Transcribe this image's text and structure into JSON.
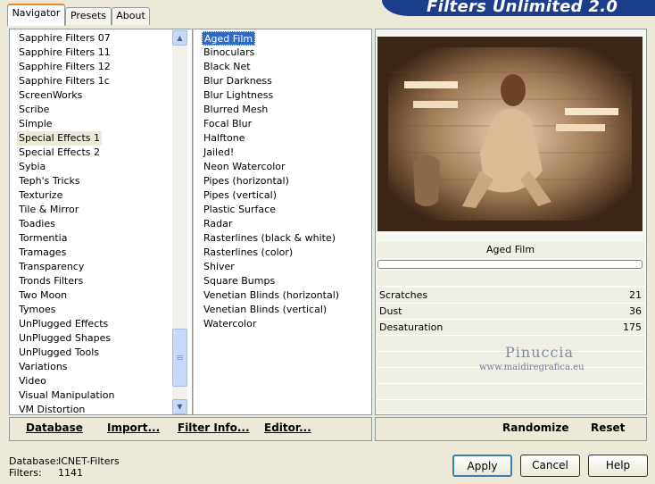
{
  "tabs": [
    "Navigator",
    "Presets",
    "About"
  ],
  "banner_title": "Filters Unlimited 2.0",
  "categories": [
    "Sapphire Filters 07",
    "Sapphire Filters 11",
    "Sapphire Filters 12",
    "Sapphire Filters 1c",
    "ScreenWorks",
    "Scribe",
    "Simple",
    "Special Effects 1",
    "Special Effects 2",
    "Sybia",
    "Teph's Tricks",
    "Texturize",
    "Tile & Mirror",
    "Toadies",
    "Tormentia",
    "Tramages",
    "Transparency",
    "Tronds Filters",
    "Two Moon",
    "Tymoes",
    "UnPlugged Effects",
    "UnPlugged Shapes",
    "UnPlugged Tools",
    "Variations",
    "Video",
    "Visual Manipulation",
    "VM Distortion"
  ],
  "selected_category": "Special Effects 1",
  "filters": [
    "Aged Film",
    "Binoculars",
    "Black Net",
    "Blur Darkness",
    "Blur Lightness",
    "Blurred Mesh",
    "Focal Blur",
    "Halftone",
    "Jailed!",
    "Neon Watercolor",
    "Pipes (horizontal)",
    "Pipes (vertical)",
    "Plastic Surface",
    "Radar",
    "Rasterlines (black & white)",
    "Rasterlines (color)",
    "Shiver",
    "Square Bumps",
    "Venetian Blinds (horizontal)",
    "Venetian Blinds (vertical)",
    "Watercolor"
  ],
  "selected_filter": "Aged Film",
  "filter_title": "Aged Film",
  "params": [
    {
      "name": "Scratches",
      "value": "21"
    },
    {
      "name": "Dust",
      "value": "36"
    },
    {
      "name": "Desaturation",
      "value": "175"
    }
  ],
  "watermark": {
    "name": "Pinuccia",
    "url": "www.maidiregrafica.eu"
  },
  "toolbar": {
    "database": "Database",
    "import": "Import...",
    "filter_info": "Filter Info...",
    "editor": "Editor...",
    "randomize": "Randomize",
    "reset": "Reset"
  },
  "status": {
    "db_label": "Database:",
    "db_value": "ICNET-Filters",
    "filters_label": "Filters:",
    "filters_value": "1141"
  },
  "buttons": {
    "apply": "Apply",
    "cancel": "Cancel",
    "help": "Help"
  },
  "colors": {
    "banner": "#1a3e8a",
    "selection": "#316ac5",
    "accent_tab": "#e68b2c"
  }
}
